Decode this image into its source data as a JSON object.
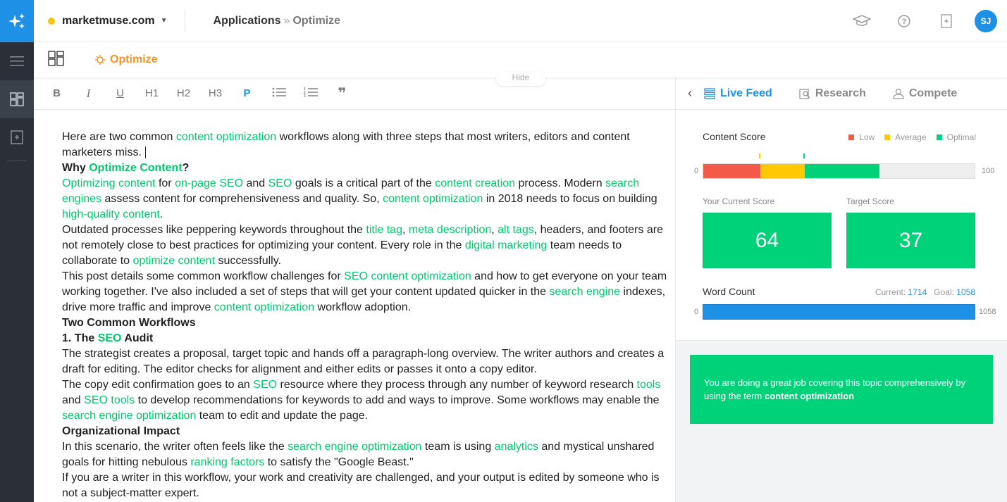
{
  "header": {
    "site": "marketmuse.com",
    "breadcrumb_root": "Applications",
    "breadcrumb_sep": "»",
    "breadcrumb_current": "Optimize",
    "avatar_initials": "SJ"
  },
  "subheader": {
    "optimize_label": "Optimize",
    "hide_label": "Hide"
  },
  "toolbar": {
    "bold": "B",
    "italic": "I",
    "underline": "U",
    "h1": "H1",
    "h2": "H2",
    "h3": "H3",
    "p": "P",
    "quote": "❞"
  },
  "editor": {
    "p1_a": "Here are two common ",
    "p1_k1": "content optimization",
    "p1_b": " workflows along with three steps that most writers, editors and content marketers miss. ",
    "h1_a": "Why ",
    "h1_k": "Optimize Content",
    "h1_b": "?",
    "p2_k1": "Optimizing content",
    "p2_a": " for ",
    "p2_k2": "on-page SEO",
    "p2_b": " and ",
    "p2_k3": "SEO",
    "p2_c": " goals is a critical part of the ",
    "p2_k4": "content creation",
    "p2_d": " process. Modern ",
    "p2_k5": "search engines",
    "p2_e": " assess content for comprehensiveness and quality. So, ",
    "p2_k6": "content optimization",
    "p2_f": " in 2018 needs to focus on building ",
    "p2_k7": "high-quality content",
    "p2_g": ".",
    "p3_a": "Outdated processes like peppering keywords throughout the ",
    "p3_k1": "title tag",
    "p3_b": ", ",
    "p3_k2": "meta description",
    "p3_c": ", ",
    "p3_k3": "alt tags",
    "p3_d": ", headers, and footers are not remotely close to best practices for optimizing your content.  Every role in the ",
    "p3_k4": "digital marketing",
    "p3_e": " team needs to collaborate to ",
    "p3_k5": "optimize content",
    "p3_f": " successfully.",
    "p4_a": "This post details some common workflow challenges for ",
    "p4_k1": "SEO content optimization",
    "p4_b": " and how to get everyone on your team working together. I've also included a set of steps that will get your content updated quicker in the ",
    "p4_k2": "search engine",
    "p4_c": " indexes, drive more traffic and improve ",
    "p4_k3": "content optimization",
    "p4_d": " workflow adoption.",
    "h2": "Two Common Workflows",
    "h3_a": "1. The ",
    "h3_k": "SEO",
    "h3_b": " Audit",
    "p5": "The strategist creates a proposal, target topic and hands off a paragraph-long overview. The writer authors and creates a draft for editing. The editor checks for alignment and either edits or passes it onto a copy editor.",
    "p6_a": "The copy edit confirmation goes to an ",
    "p6_k1": "SEO",
    "p6_b": " resource where they process through any number of keyword research ",
    "p6_k2": "tools",
    "p6_c": " and ",
    "p6_k3": "SEO tools",
    "p6_d": " to develop recommendations for keywords to add and ways to improve. Some workflows may enable the ",
    "p6_k4": "search engine optimization",
    "p6_e": " team to edit and update the page.",
    "h4": "Organizational Impact",
    "p7_a": "In this scenario, the writer often feels like the ",
    "p7_k1": "search engine optimization",
    "p7_b": " team is using ",
    "p7_k2": "analytics",
    "p7_c": " and mystical unshared goals for hitting nebulous ",
    "p7_k3": "ranking factors",
    "p7_d": " to satisfy the \"Google Beast.\"",
    "p8": "If you are a writer in this workflow, your work and creativity are challenged, and your output is edited by someone who is not a subject-matter expert."
  },
  "panel": {
    "tabs": [
      "Live Feed",
      "Research",
      "Compete"
    ],
    "content_score_label": "Content Score",
    "legend": [
      "Low",
      "Average",
      "Optimal"
    ],
    "score_min": "0",
    "score_max": "100",
    "current_score_label": "Your Current Score",
    "target_score_label": "Target Score",
    "current_score": "64",
    "target_score": "37",
    "word_count_label": "Word Count",
    "wc_current_label": "Current:",
    "wc_current": "1714",
    "wc_goal_label": "Goal:",
    "wc_goal": "1058",
    "wc_min": "0",
    "wc_max": "1058",
    "tip_text": "You are doing a great job covering this topic comprehensively by using the term ",
    "tip_term": "content optimization"
  },
  "colors": {
    "accent": "#1e90e6",
    "keyword": "#00c96b",
    "low": "#f45a48",
    "average": "#ffc800",
    "optimal": "#00d27a",
    "orange": "#f7931e"
  },
  "score_bar": {
    "low_end": 21,
    "average_end": 37.5,
    "optimal_end": 65
  }
}
